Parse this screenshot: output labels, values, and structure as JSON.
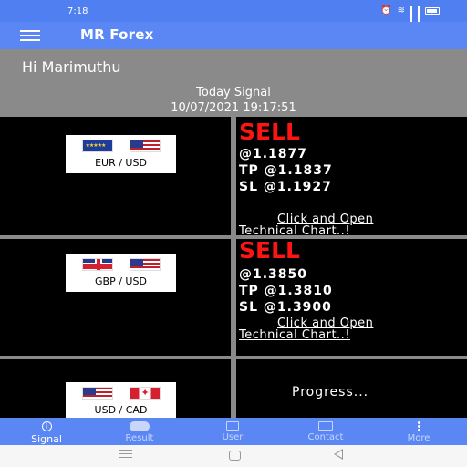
{
  "status_bar": {
    "time": "7:18"
  },
  "app_bar": {
    "title": "MR Forex"
  },
  "header": {
    "greeting": "Hi Marimuthu",
    "today_label": "Today Signal",
    "today_datetime": "10/07/2021 19:17:51"
  },
  "signals": [
    {
      "pair": "EUR / USD",
      "flags": [
        "eu-flag-icon",
        "us-flag-icon"
      ],
      "type": "SELL",
      "entry": "@1.1877",
      "tp": "TP @1.1837",
      "sl": "SL @1.1927",
      "link_line1": "Click and Open",
      "link_line2": "Technical Chart..!"
    },
    {
      "pair": "GBP / USD",
      "flags": [
        "uk-flag-icon",
        "us-flag-icon"
      ],
      "type": "SELL",
      "entry": "@1.3850",
      "tp": "TP @1.3810",
      "sl": "SL @1.3900",
      "link_line1": "Click and Open",
      "link_line2": "Technical Chart..!"
    },
    {
      "pair": "USD / CAD",
      "flags": [
        "us-flag-icon",
        "ca-flag-icon"
      ],
      "status": "Progress..."
    }
  ],
  "bottom_nav": {
    "items": [
      {
        "label": "Signal",
        "icon": "info-icon",
        "active": true
      },
      {
        "label": "Result",
        "icon": "result-icon",
        "active": false
      },
      {
        "label": "User",
        "icon": "user-icon",
        "active": false
      },
      {
        "label": "Contact",
        "icon": "contact-icon",
        "active": false
      },
      {
        "label": "More",
        "icon": "more-icon",
        "active": false
      }
    ]
  },
  "colors": {
    "primary": "#5b87f5",
    "header_gray": "#8a8a8a",
    "sell_red": "#ff1414"
  }
}
